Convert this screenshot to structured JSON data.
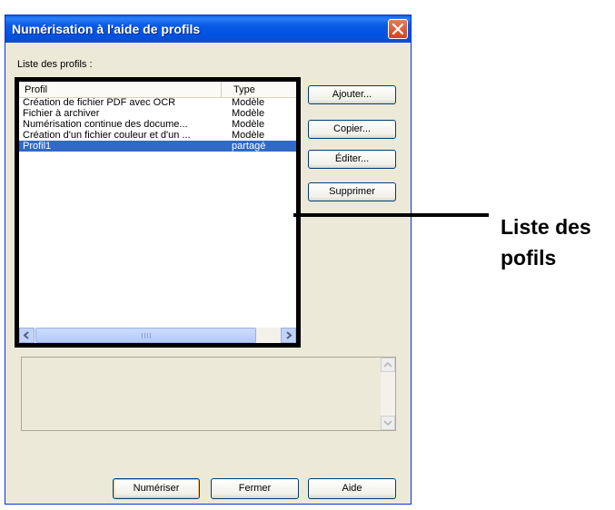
{
  "window": {
    "title": "Numérisation à l'aide de profils",
    "profiles_label": "Liste des profils :"
  },
  "listview": {
    "columns": {
      "profil": "Profil",
      "type": "Type"
    },
    "rows": [
      {
        "name": "Création de fichier PDF avec OCR",
        "type": "Modèle",
        "selected": false
      },
      {
        "name": "Fichier à archiver",
        "type": "Modèle",
        "selected": false
      },
      {
        "name": "Numérisation continue des docume...",
        "type": "Modèle",
        "selected": false
      },
      {
        "name": "Création d'un fichier couleur et d'un ...",
        "type": "Modèle",
        "selected": false
      },
      {
        "name": "Profil1",
        "type": "partagé",
        "selected": true
      }
    ]
  },
  "side_buttons": {
    "add": "Ajouter...",
    "copy": "Copier...",
    "edit": "Éditer...",
    "delete": "Supprimer"
  },
  "bottom_buttons": {
    "scan": "Numériser",
    "close": "Fermer",
    "help": "Aide"
  },
  "callout": {
    "line1": "Liste des",
    "line2": "pofils"
  },
  "colors": {
    "title_bar": "#0053e1",
    "selection": "#316ac5",
    "close_button": "#d0441f"
  },
  "icons": {
    "close": "close-icon",
    "scroll_left": "arrow-left-icon",
    "scroll_right": "arrow-right-icon",
    "scroll_up": "arrow-up-icon",
    "scroll_down": "arrow-down-icon"
  }
}
